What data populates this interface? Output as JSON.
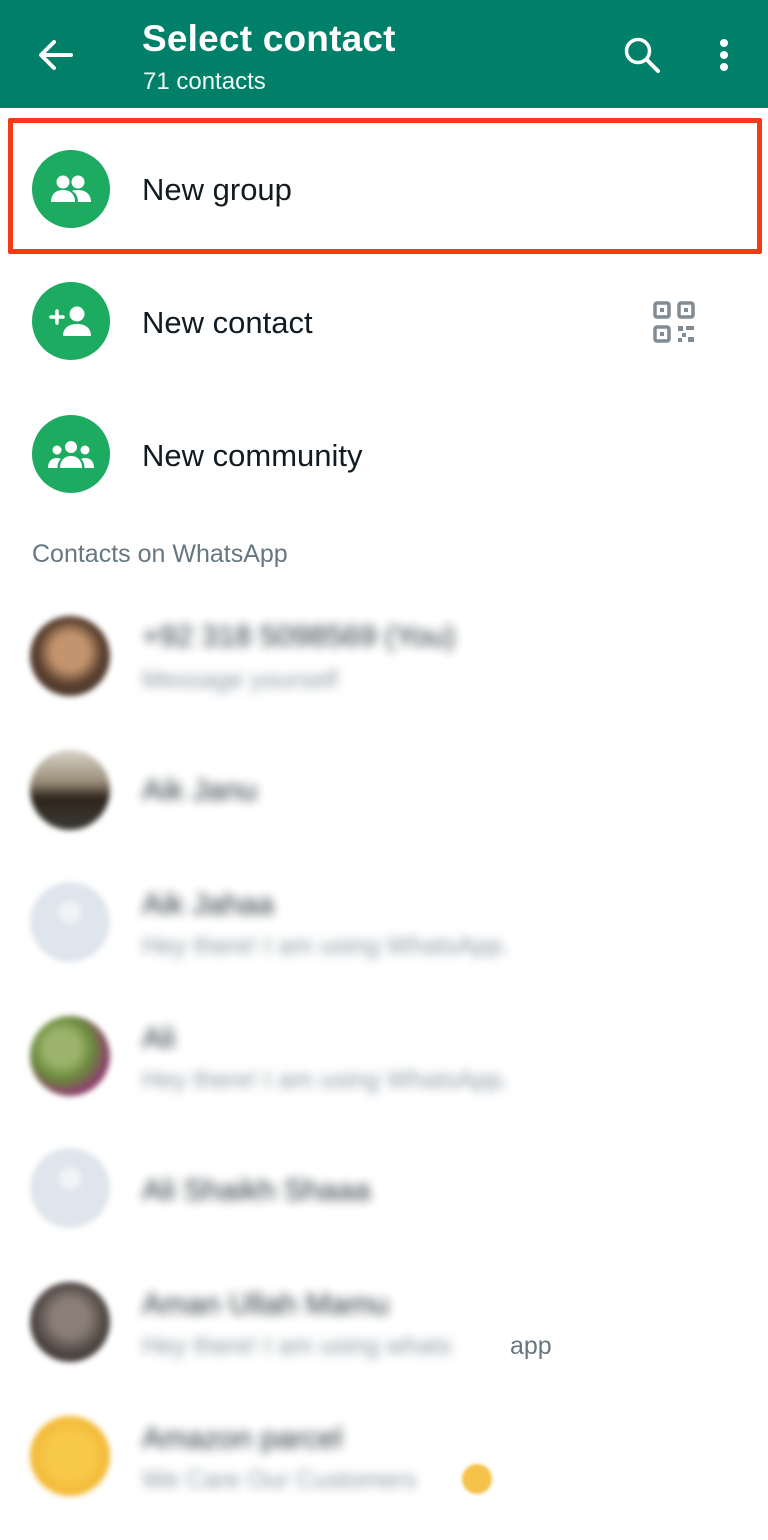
{
  "appbar": {
    "title": "Select contact",
    "subtitle": "71 contacts",
    "background": "#008069"
  },
  "actions": [
    {
      "label": "New group",
      "icon": "group-icon"
    },
    {
      "label": "New contact",
      "icon": "add-person-icon",
      "trailing_icon": "qr-code-icon"
    },
    {
      "label": "New community",
      "icon": "community-icon"
    }
  ],
  "section_header": "Contacts on WhatsApp",
  "contacts": [
    {
      "name": "+92 318 5098569 (You)",
      "status": "Message yourself",
      "avatar": "photo"
    },
    {
      "name": "Aik Janu",
      "status": "",
      "avatar": "photo"
    },
    {
      "name": "Aik Jahaa",
      "status": "Hey there! I am using WhatsApp.",
      "avatar": "default"
    },
    {
      "name": "Ali",
      "status": "Hey there! I am using WhatsApp.",
      "avatar": "photo"
    },
    {
      "name": "Ali Shaikh Shaaa",
      "status": "",
      "avatar": "default"
    },
    {
      "name": "Aman Ullah Mamu",
      "status": "Hey there! I am using whats",
      "status_suffix": "app",
      "avatar": "photo"
    },
    {
      "name": "Amazon parcel",
      "status": "We Care Our Customers",
      "avatar": "photo"
    }
  ],
  "colors": {
    "accent_green": "#1daa61",
    "highlight_red": "#f53a16",
    "primary_text": "#111b21",
    "secondary_text": "#667781"
  }
}
